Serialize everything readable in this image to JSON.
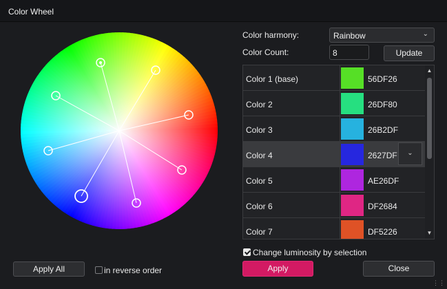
{
  "window": {
    "title": "Color Wheel"
  },
  "harmony": {
    "label": "Color harmony:",
    "selected": "Rainbow"
  },
  "count": {
    "label": "Color Count:",
    "value": "8"
  },
  "buttons": {
    "update": "Update",
    "apply_all": "Apply All",
    "apply": "Apply",
    "close": "Close"
  },
  "reverse_label": "in reverse order",
  "luminosity_label": "Change luminosity by selection",
  "colors": [
    {
      "name": "Color 1 (base)",
      "hex": "56DF26",
      "swatch": "#56DF26"
    },
    {
      "name": "Color 2",
      "hex": "26DF80",
      "swatch": "#26DF80"
    },
    {
      "name": "Color 3",
      "hex": "26B2DF",
      "swatch": "#26B2DF"
    },
    {
      "name": "Color 4",
      "hex": "2627DF",
      "swatch": "#2627DF"
    },
    {
      "name": "Color 5",
      "hex": "AE26DF",
      "swatch": "#AE26DF"
    },
    {
      "name": "Color 6",
      "hex": "DF2684",
      "swatch": "#DF2684"
    },
    {
      "name": "Color 7",
      "hex": "DF5226",
      "swatch": "#DF5226"
    }
  ],
  "selected_color_index": 3,
  "reverse_order_checked": false,
  "luminosity_checked": true,
  "accent_color": "#d31a63"
}
